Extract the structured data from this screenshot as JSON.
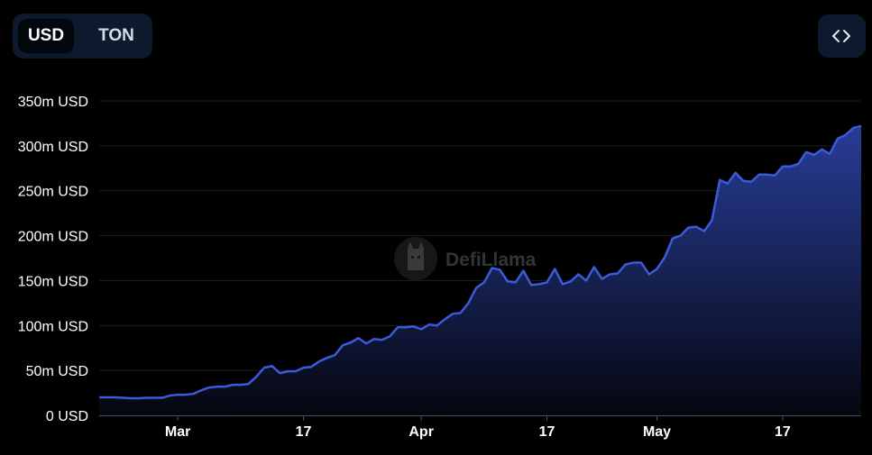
{
  "currency_toggle": {
    "options": [
      {
        "label": "USD",
        "active": true
      },
      {
        "label": "TON",
        "active": false
      }
    ]
  },
  "embed_button": {
    "icon": "code-brackets-icon"
  },
  "watermark": {
    "label": "DefiLlama",
    "icon": "llama-logo-icon"
  },
  "colors": {
    "line": "#3b5bdb",
    "fill_top": "#2a3f9e",
    "fill_bottom": "#05070f",
    "grid": "#1a1f28"
  },
  "chart_data": {
    "type": "area",
    "title": "",
    "xlabel": "",
    "ylabel": "",
    "x_ticks": [
      {
        "label": "Mar",
        "date": "2024-03-01",
        "major": true
      },
      {
        "label": "17",
        "date": "2024-03-17",
        "major": false
      },
      {
        "label": "Apr",
        "date": "2024-04-01",
        "major": true
      },
      {
        "label": "17",
        "date": "2024-04-17",
        "major": false
      },
      {
        "label": "May",
        "date": "2024-05-01",
        "major": true
      },
      {
        "label": "17",
        "date": "2024-05-17",
        "major": false
      }
    ],
    "y_ticks": [
      "0 USD",
      "50m USD",
      "100m USD",
      "150m USD",
      "200m USD",
      "250m USD",
      "300m USD",
      "350m USD"
    ],
    "ylim": [
      0,
      350
    ],
    "grid": true,
    "series": [
      {
        "unit": "m USD",
        "points": [
          [
            "2024-02-20",
            20
          ],
          [
            "2024-02-21",
            20
          ],
          [
            "2024-02-22",
            20
          ],
          [
            "2024-02-23",
            19.5
          ],
          [
            "2024-02-24",
            19
          ],
          [
            "2024-02-25",
            19
          ],
          [
            "2024-02-26",
            19.5
          ],
          [
            "2024-02-27",
            19.5
          ],
          [
            "2024-02-28",
            19.5
          ],
          [
            "2024-02-29",
            22
          ],
          [
            "2024-03-01",
            23
          ],
          [
            "2024-03-02",
            23
          ],
          [
            "2024-03-03",
            24
          ],
          [
            "2024-03-04",
            28
          ],
          [
            "2024-03-05",
            31
          ],
          [
            "2024-03-06",
            32
          ],
          [
            "2024-03-07",
            32
          ],
          [
            "2024-03-08",
            34
          ],
          [
            "2024-03-09",
            34
          ],
          [
            "2024-03-10",
            35
          ],
          [
            "2024-03-11",
            43
          ],
          [
            "2024-03-12",
            53
          ],
          [
            "2024-03-13",
            55
          ],
          [
            "2024-03-14",
            47
          ],
          [
            "2024-03-15",
            49
          ],
          [
            "2024-03-16",
            49
          ],
          [
            "2024-03-17",
            53
          ],
          [
            "2024-03-18",
            54
          ],
          [
            "2024-03-19",
            60
          ],
          [
            "2024-03-20",
            64
          ],
          [
            "2024-03-21",
            67
          ],
          [
            "2024-03-22",
            78
          ],
          [
            "2024-03-23",
            81
          ],
          [
            "2024-03-24",
            86
          ],
          [
            "2024-03-25",
            80
          ],
          [
            "2024-03-26",
            85
          ],
          [
            "2024-03-27",
            84
          ],
          [
            "2024-03-28",
            88
          ],
          [
            "2024-03-29",
            98
          ],
          [
            "2024-03-30",
            98
          ],
          [
            "2024-03-31",
            99
          ],
          [
            "2024-04-01",
            96
          ],
          [
            "2024-04-02",
            101
          ],
          [
            "2024-04-03",
            100
          ],
          [
            "2024-04-04",
            107
          ],
          [
            "2024-04-05",
            113
          ],
          [
            "2024-04-06",
            114
          ],
          [
            "2024-04-07",
            125
          ],
          [
            "2024-04-08",
            142
          ],
          [
            "2024-04-09",
            148
          ],
          [
            "2024-04-10",
            164
          ],
          [
            "2024-04-11",
            162
          ],
          [
            "2024-04-12",
            149
          ],
          [
            "2024-04-13",
            148
          ],
          [
            "2024-04-14",
            161
          ],
          [
            "2024-04-15",
            145
          ],
          [
            "2024-04-16",
            146
          ],
          [
            "2024-04-17",
            148
          ],
          [
            "2024-04-18",
            163
          ],
          [
            "2024-04-19",
            146
          ],
          [
            "2024-04-20",
            149
          ],
          [
            "2024-04-21",
            157
          ],
          [
            "2024-04-22",
            150
          ],
          [
            "2024-04-23",
            165
          ],
          [
            "2024-04-24",
            152
          ],
          [
            "2024-04-25",
            157
          ],
          [
            "2024-04-26",
            158
          ],
          [
            "2024-04-27",
            168
          ],
          [
            "2024-04-28",
            170
          ],
          [
            "2024-04-29",
            170
          ],
          [
            "2024-04-30",
            157
          ],
          [
            "2024-05-01",
            163
          ],
          [
            "2024-05-02",
            176
          ],
          [
            "2024-05-03",
            197
          ],
          [
            "2024-05-04",
            200
          ],
          [
            "2024-05-05",
            209
          ],
          [
            "2024-05-06",
            210
          ],
          [
            "2024-05-07",
            205
          ],
          [
            "2024-05-08",
            217
          ],
          [
            "2024-05-09",
            262
          ],
          [
            "2024-05-10",
            258
          ],
          [
            "2024-05-11",
            270
          ],
          [
            "2024-05-12",
            261
          ],
          [
            "2024-05-13",
            260
          ],
          [
            "2024-05-14",
            268
          ],
          [
            "2024-05-15",
            268
          ],
          [
            "2024-05-16",
            267
          ],
          [
            "2024-05-17",
            277
          ],
          [
            "2024-05-18",
            277
          ],
          [
            "2024-05-19",
            280
          ],
          [
            "2024-05-20",
            293
          ],
          [
            "2024-05-21",
            290
          ],
          [
            "2024-05-22",
            296
          ],
          [
            "2024-05-23",
            291
          ],
          [
            "2024-05-24",
            308
          ],
          [
            "2024-05-25",
            312
          ],
          [
            "2024-05-26",
            320
          ],
          [
            "2024-05-27",
            322
          ]
        ]
      }
    ]
  }
}
